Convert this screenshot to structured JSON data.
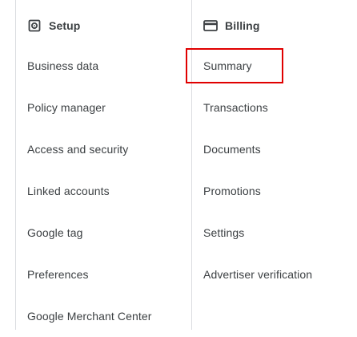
{
  "setup": {
    "title": "Setup",
    "icon": "gear-box-icon",
    "items": [
      {
        "label": "Business data"
      },
      {
        "label": "Policy manager"
      },
      {
        "label": "Access and security"
      },
      {
        "label": "Linked accounts"
      },
      {
        "label": "Google tag"
      },
      {
        "label": "Preferences"
      },
      {
        "label": "Google Merchant Center"
      }
    ]
  },
  "billing": {
    "title": "Billing",
    "icon": "credit-card-icon",
    "items": [
      {
        "label": "Summary",
        "highlighted": true
      },
      {
        "label": "Transactions"
      },
      {
        "label": "Documents"
      },
      {
        "label": "Promotions"
      },
      {
        "label": "Settings"
      },
      {
        "label": "Advertiser verification"
      }
    ]
  },
  "colors": {
    "text": "#3c4043",
    "divider": "#dadce0",
    "highlight": "#e00000"
  }
}
